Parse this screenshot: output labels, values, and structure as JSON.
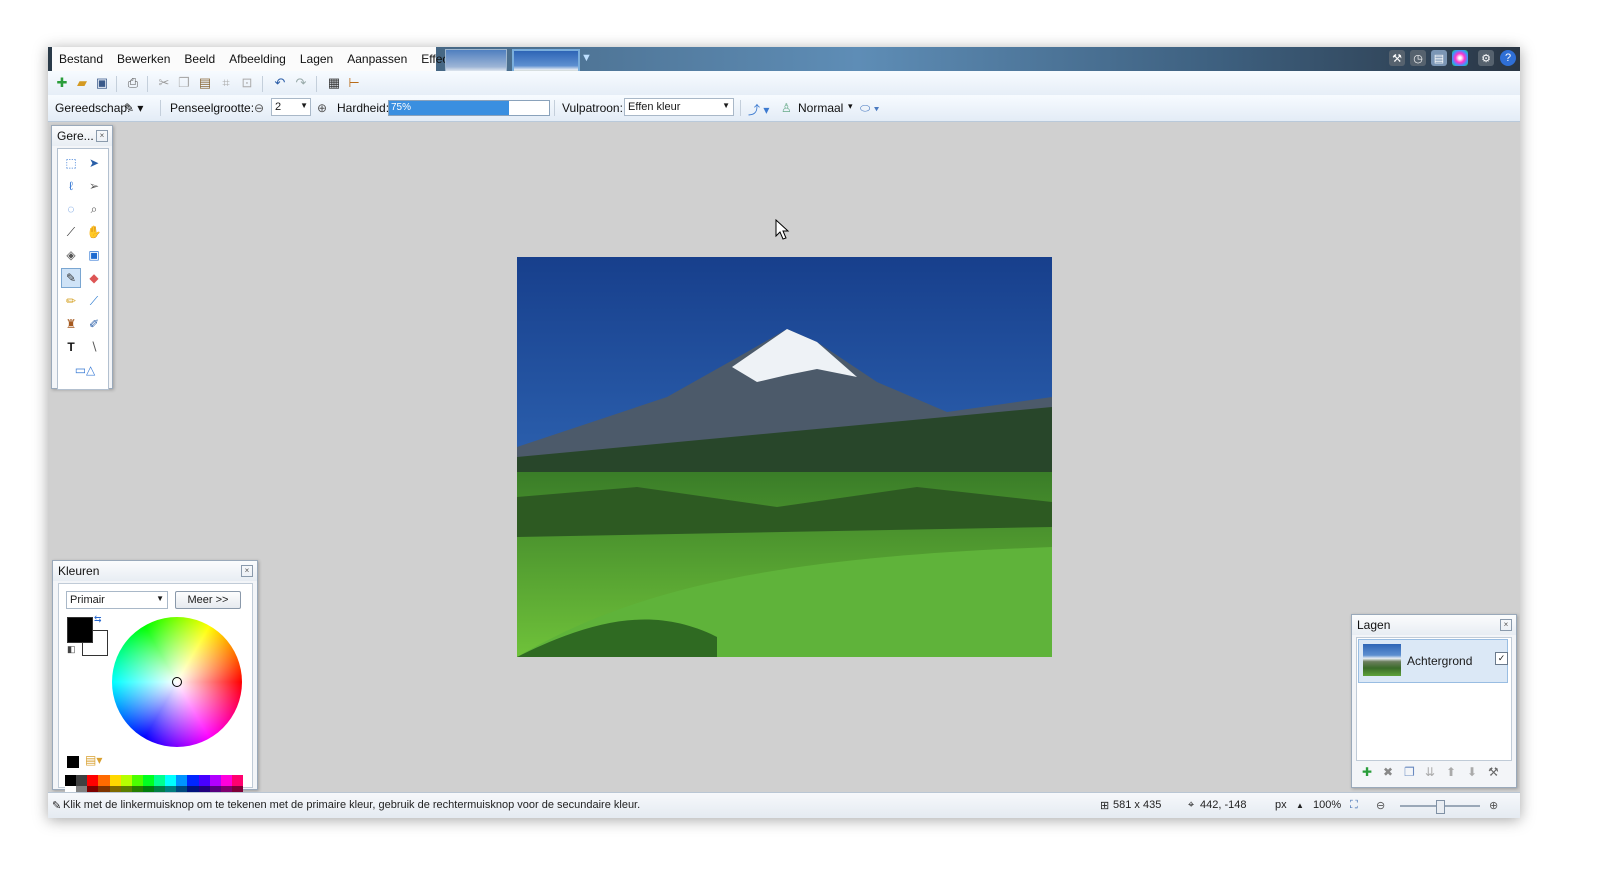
{
  "menu": {
    "items": [
      "Bestand",
      "Bewerken",
      "Beeld",
      "Afbeelding",
      "Lagen",
      "Aanpassen",
      "Effecten"
    ]
  },
  "toolbar2": {
    "tool_label": "Gereedschap:",
    "brush_size_label": "Penseelgrootte:",
    "brush_size_value": "2",
    "hardness_label": "Hardheid:",
    "hardness_value": "75%",
    "hardness_fraction": 0.75,
    "fill_label": "Vulpatroon:",
    "fill_value": "Effen kleur",
    "blend_value": "Normaal"
  },
  "tools_panel": {
    "title": "Gere..."
  },
  "colors_panel": {
    "title": "Kleuren",
    "mode_value": "Primair",
    "more_button": "Meer >>",
    "primary_color": "#000000",
    "secondary_color": "#ffffff"
  },
  "layers_panel": {
    "title": "Lagen",
    "layers": [
      {
        "name": "Achtergrond",
        "visible": true
      }
    ]
  },
  "status": {
    "hint": "Klik met de linkermuisknop om te tekenen met de primaire kleur, gebruik de rechtermuisknop voor de secundaire kleur.",
    "image_size": "581 x 435",
    "cursor_pos": "442, -148",
    "unit": "px",
    "zoom": "100%"
  }
}
